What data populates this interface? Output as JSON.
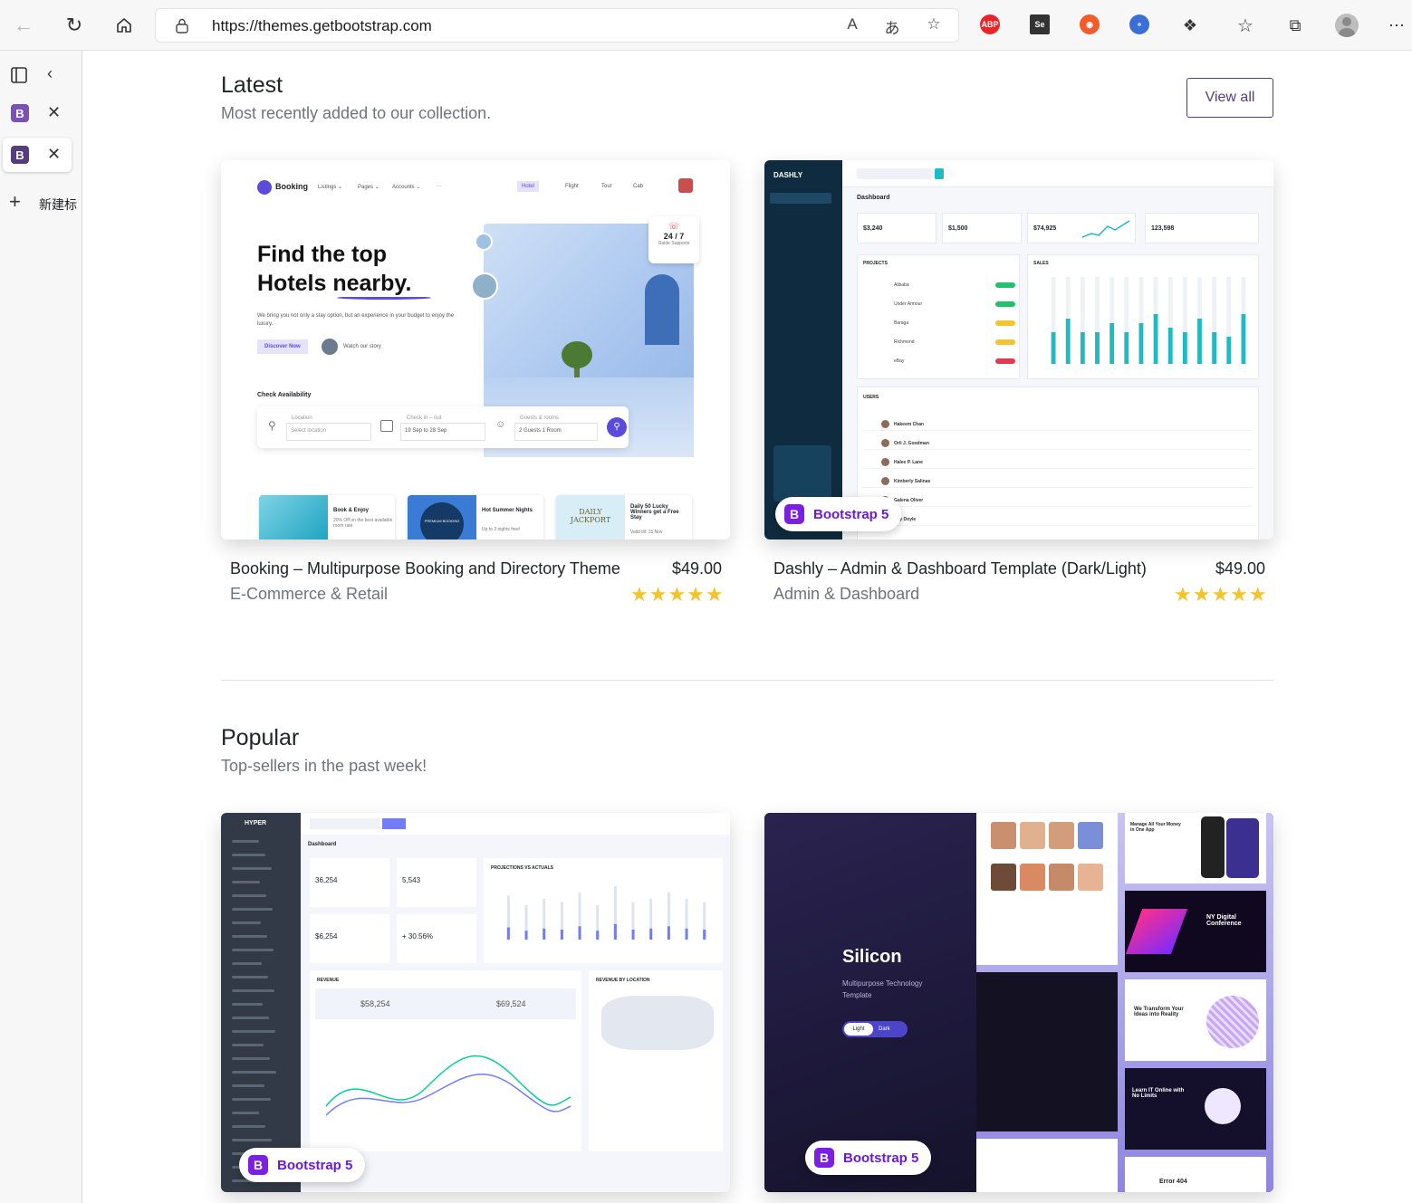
{
  "browser": {
    "url": "https://themes.getbootstrap.com",
    "new_tab_label": "新建标",
    "read_aloud_icon": "A",
    "translate_icon": "あ",
    "ext_abp": "ABP",
    "ext_se": "Se"
  },
  "latest": {
    "title": "Latest",
    "subtitle": "Most recently added to our collection.",
    "view_all": "View all",
    "cards": [
      {
        "title": "Booking – Multipurpose Booking and Directory Theme",
        "category": "E-Commerce & Retail",
        "price": "$49.00",
        "stars": "★★★★★"
      },
      {
        "title": "Dashly – Admin & Dashboard Template (Dark/Light)",
        "category": "Admin & Dashboard",
        "price": "$49.00",
        "stars": "★★★★★"
      }
    ]
  },
  "popular": {
    "title": "Popular",
    "subtitle": "Top-sellers in the past week!"
  },
  "badge": {
    "letter": "B",
    "text": "Bootstrap 5"
  },
  "booking_mock": {
    "brand": "Booking",
    "nav": [
      "Listings ⌄",
      "Pages ⌄",
      "Accounts ⌄",
      "···"
    ],
    "tabs": [
      "Hotel",
      "Flight",
      "Tour",
      "Cab"
    ],
    "headline1": "Find the top",
    "headline2": "Hotels nearby.",
    "lead": "We bring you not only a stay option, but an experience in your budget to enjoy the luxury.",
    "cta": "Discover Now",
    "watch": "Watch our story",
    "check": "Check Availability",
    "location_label": "Location",
    "location_value": "Select location",
    "checkin_label": "Check in – out",
    "checkin_value": "19 Sep to 28 Sep",
    "guests_label": "Guests & rooms",
    "guests_value": "2 Guests 1 Room",
    "support": "24 / 7",
    "support_sub": "Guide Supports",
    "promo1_title": "Book & Enjoy",
    "promo1_sub": "20% Off on the best available room rate",
    "promo2_title": "Hot Summer Nights",
    "promo2_sub": "Up to 3 nights free!",
    "promo3_title": "Daily 50 Lucky Winners get a Free Stay",
    "promo3_sub": "Valid till: 15 Nov",
    "promo3_img": "DAILY JACKPORT",
    "promo2_img": "PREMIUM BOOKING"
  },
  "dashly_mock": {
    "brand": "DASHLY",
    "heading": "Dashboard",
    "stats": [
      "$3,240",
      "$1,500",
      "$74,925",
      "123,598"
    ],
    "projects_label": "PROJECTS",
    "sales_label": "SALES",
    "users_label": "USERS",
    "project_rows": [
      "Alibaba",
      "Under Armour",
      "Baraga",
      "Richmond",
      "eBay"
    ],
    "user_rows": [
      "Hakeem Chan",
      "Orli J. Goodman",
      "Halee P. Lane",
      "Kimberly Salinas",
      "Galena Oliver",
      "Ally Doyle"
    ],
    "bars": [
      0.35,
      0.5,
      0.35,
      0.35,
      0.45,
      0.35,
      0.45,
      0.55,
      0.4,
      0.35,
      0.5,
      0.35,
      0.3,
      0.55
    ]
  },
  "hyper_mock": {
    "brand": "HYPER",
    "heading": "Dashboard",
    "customers": "36,254",
    "orders": "5,543",
    "revenue": "$6,254",
    "growth": "+ 30.56%",
    "revenue_label": "REVENUE",
    "current_week": "$58,254",
    "previous_week": "$69,524",
    "projections": "PROJECTIONS VS ACTUALS",
    "by_location": "REVENUE BY LOCATION",
    "bars": [
      0.55,
      0.4,
      0.5,
      0.45,
      0.6,
      0.4,
      0.7,
      0.45,
      0.5,
      0.6,
      0.5,
      0.45
    ]
  },
  "silicon_mock": {
    "title": "Silicon",
    "sub": "Multipurpose Technology Template",
    "light": "Light",
    "dark": "Dark",
    "conference": "NY Digital Conference",
    "transform": "We Transform Your Ideas into Reality",
    "learn": "Learn IT Online with No Limits",
    "error": "Error 404",
    "manage": "Manage All Your Money in One App"
  }
}
